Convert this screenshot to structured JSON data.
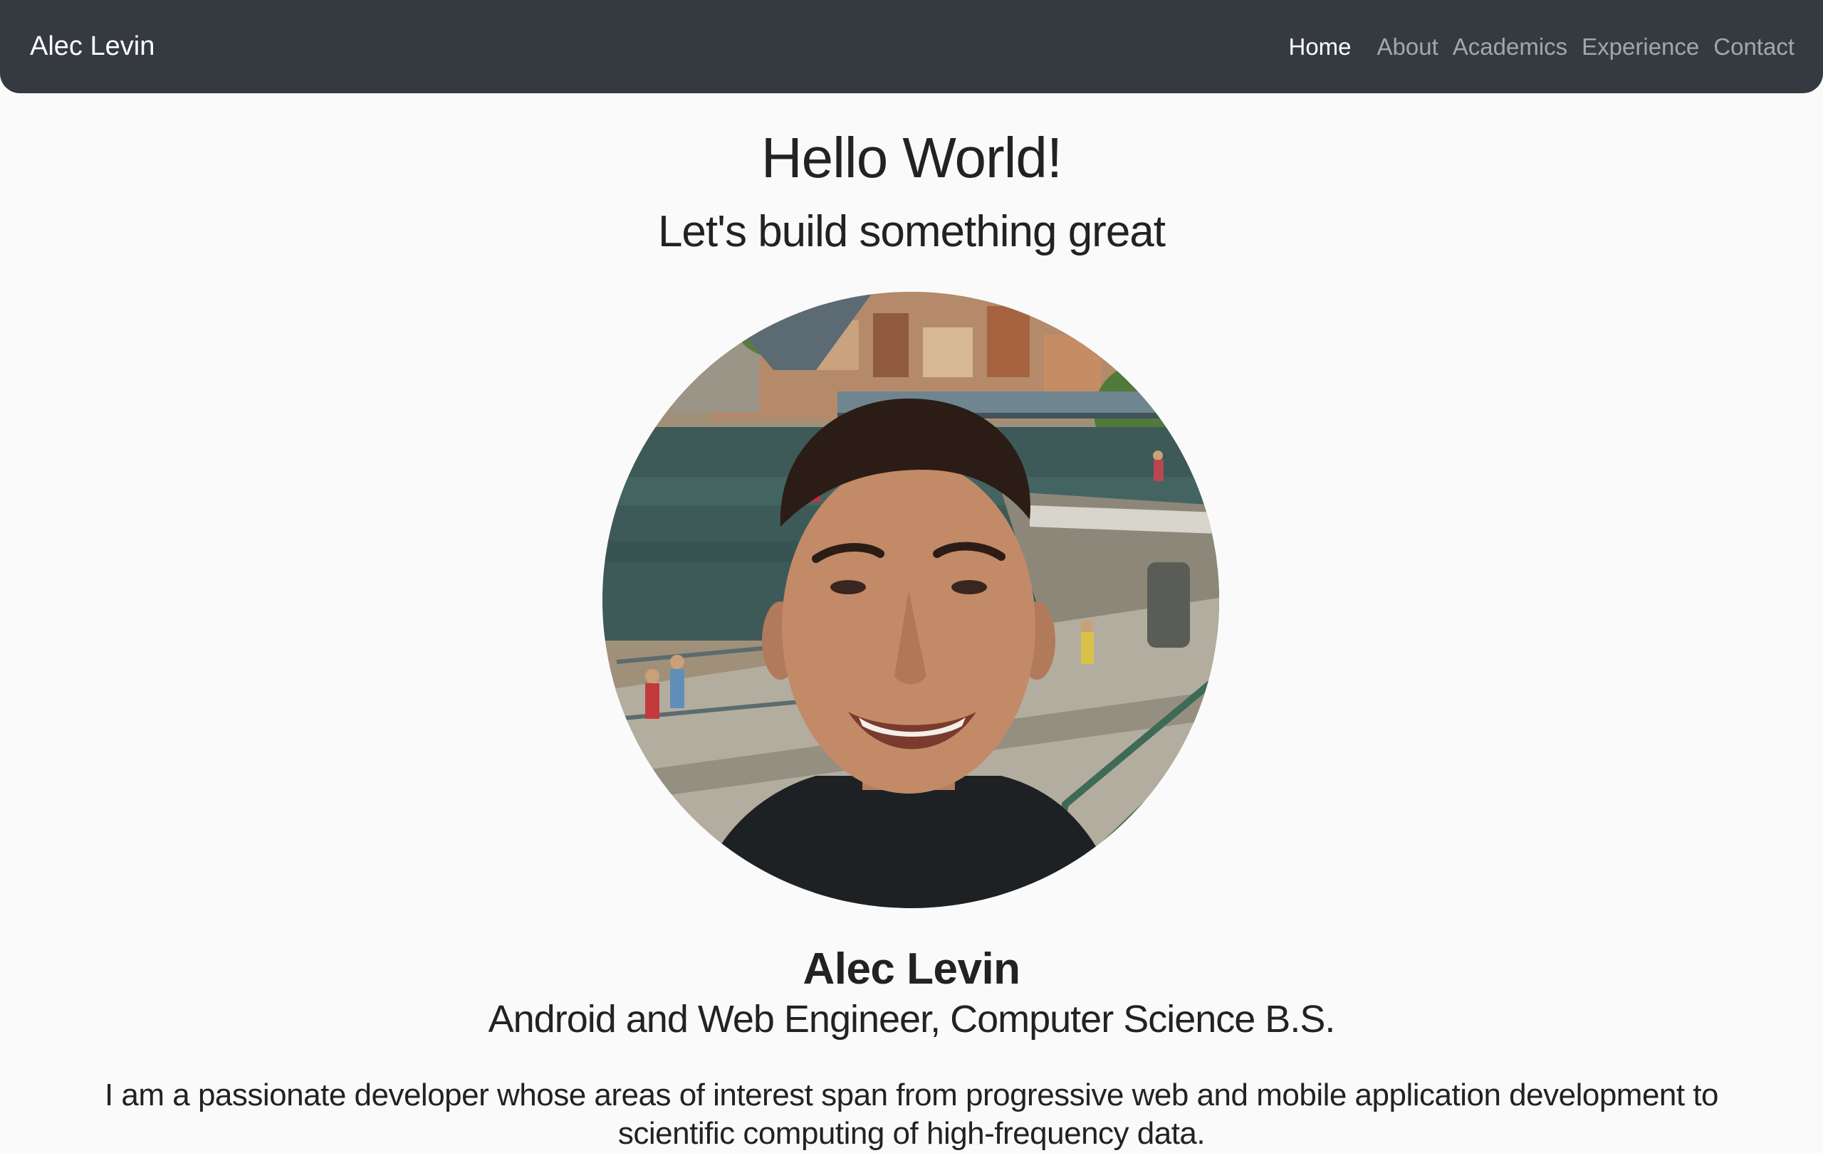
{
  "navbar": {
    "brand": "Alec Levin",
    "links": [
      "Home",
      "About",
      "Academics",
      "Experience",
      "Contact"
    ],
    "active": "Home",
    "background": "#343a40"
  },
  "hero": {
    "title": "Hello World!",
    "subtitle": "Let's build something great"
  },
  "profile": {
    "name": "Alec Levin",
    "role": "Android and Web Engineer, Computer Science B.S.",
    "bio": "I am a passionate developer whose areas of interest span from progressive web and mobile application development to scientific computing of high-frequency data."
  }
}
